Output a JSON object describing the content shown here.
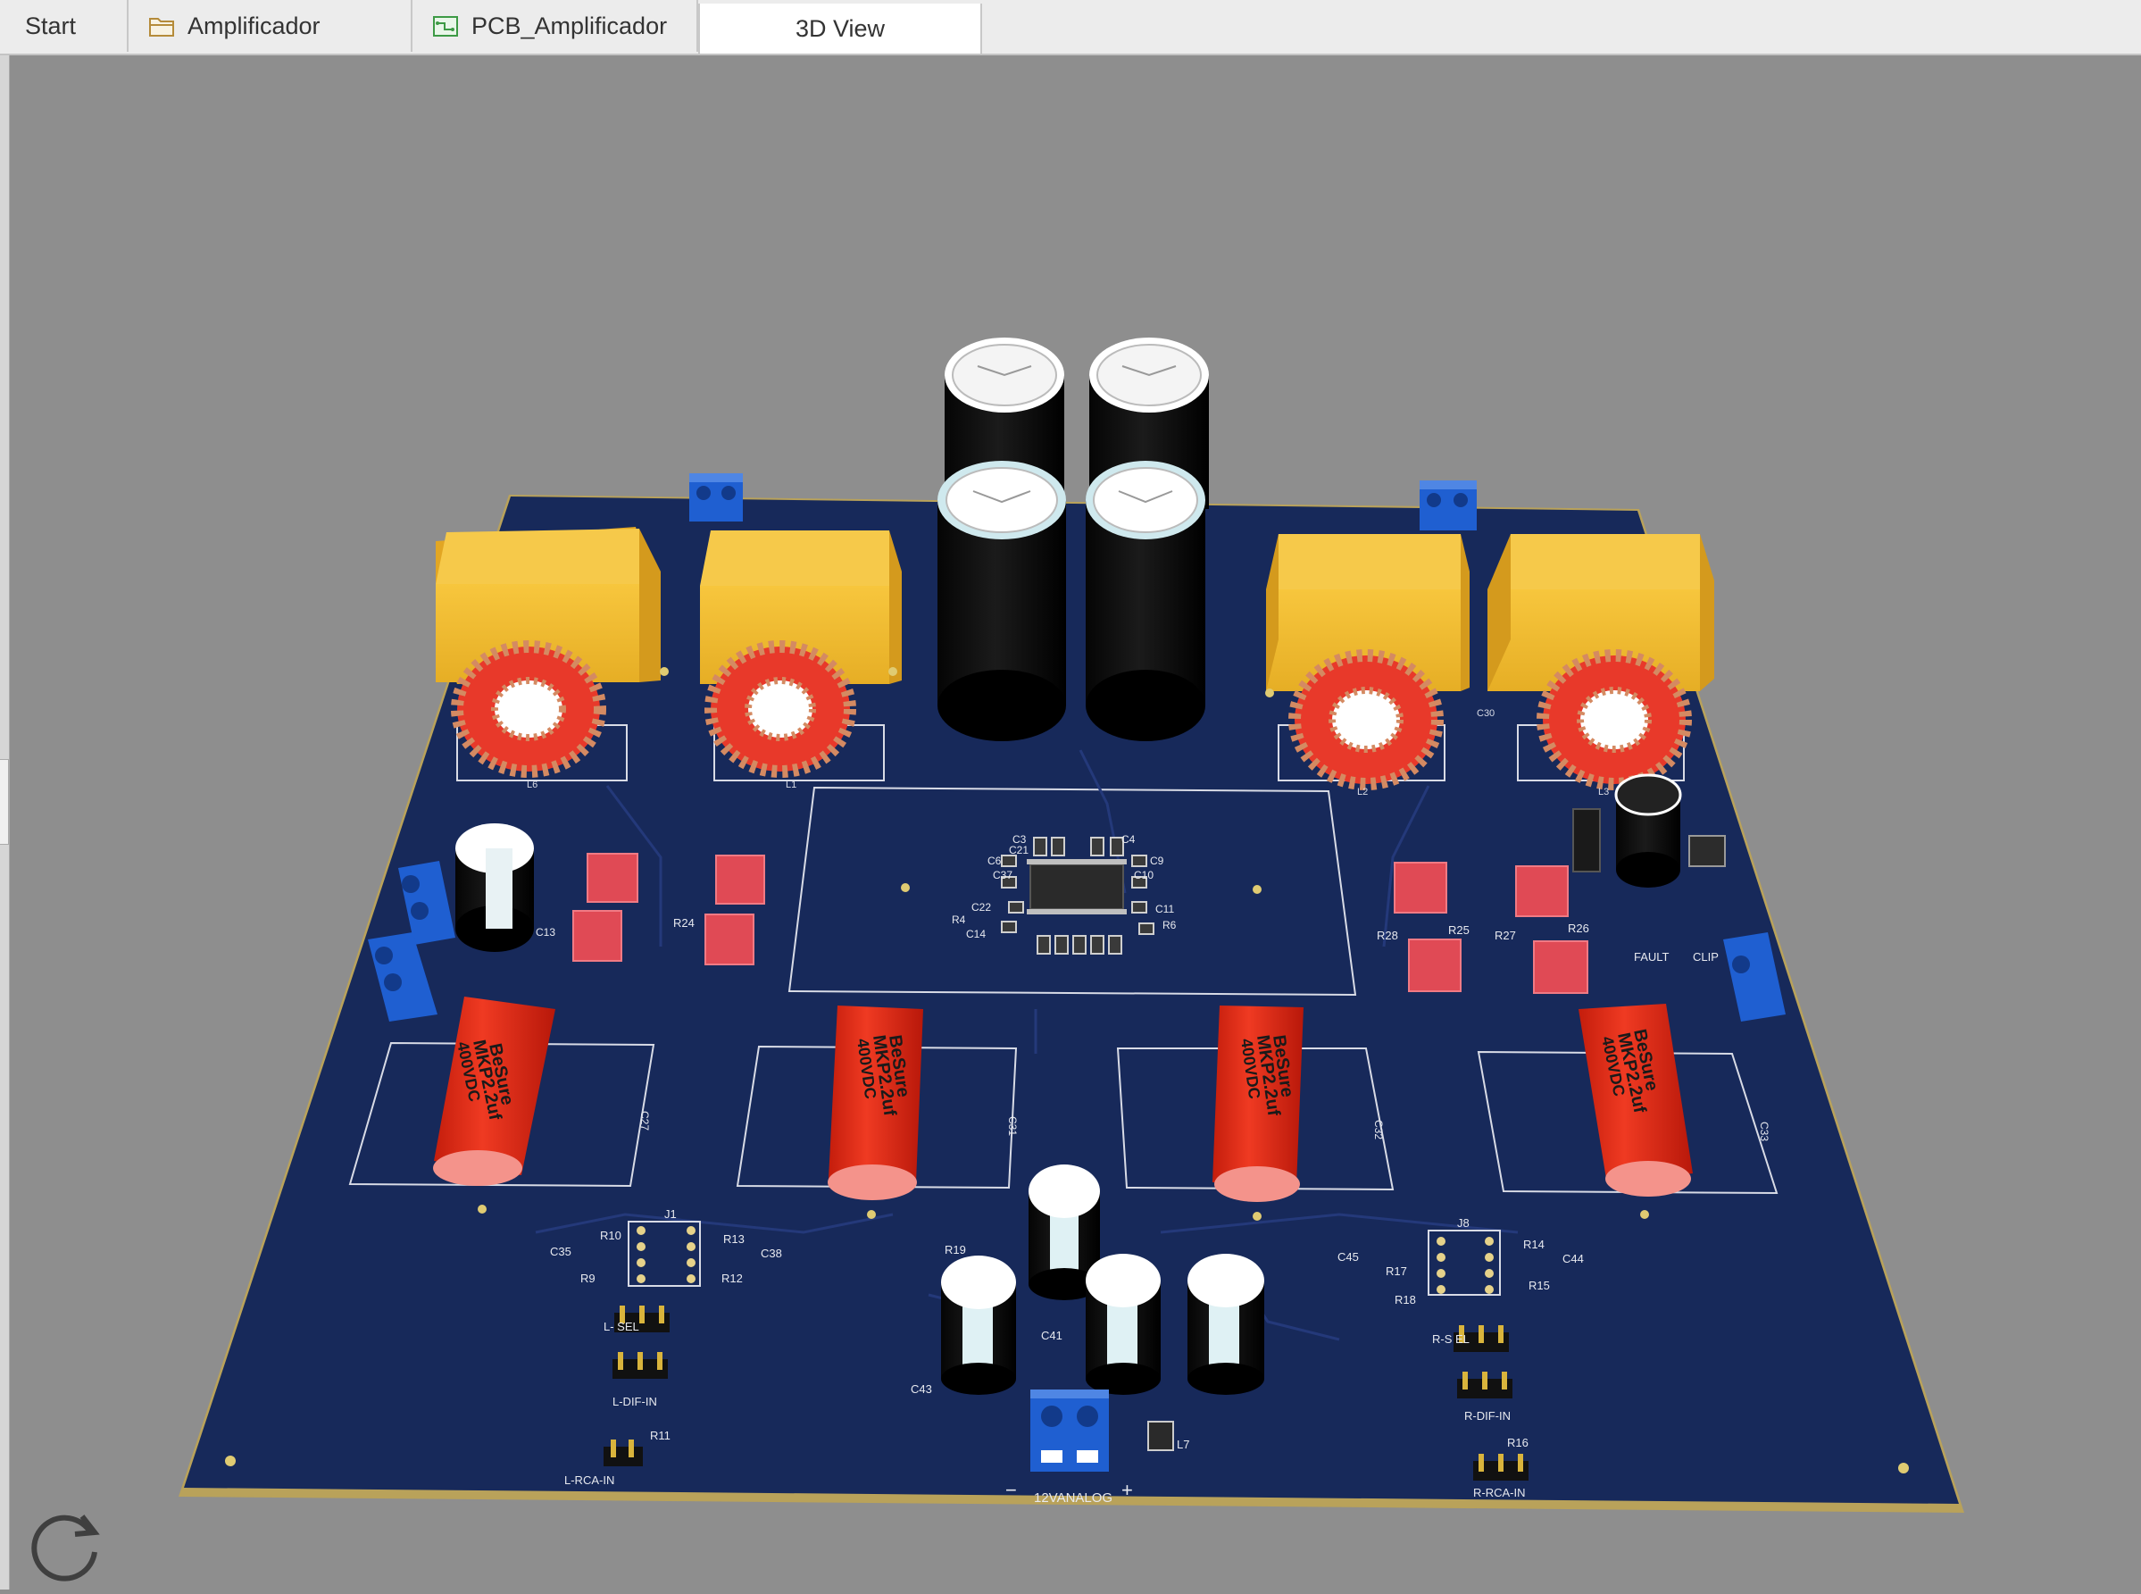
{
  "tabs": [
    {
      "label": "Start",
      "icon": "none"
    },
    {
      "label": "Amplificador",
      "icon": "folder-icon"
    },
    {
      "label": "PCB_Amplificador",
      "icon": "pcb-document-icon"
    },
    {
      "label": "3D View",
      "icon": "none"
    }
  ],
  "active_tab": "3D View",
  "pcb": {
    "inductor_labels": [
      "L6",
      "L1",
      "L2",
      "L3"
    ],
    "film_caps": [
      {
        "brand": "BeSure",
        "spec": "MKP2.2uf",
        "voltage": "400VDC",
        "ref": "C27"
      },
      {
        "brand": "BeSure",
        "spec": "MKP2.2uf",
        "voltage": "400VDC",
        "ref": "C31"
      },
      {
        "brand": "BeSure",
        "spec": "MKP2.2uf",
        "voltage": "400VDC",
        "ref": "C32"
      },
      {
        "brand": "BeSure",
        "spec": "MKP2.2uf",
        "voltage": "400VDC",
        "ref": "C33"
      }
    ],
    "refs": {
      "c3": "C3",
      "c4": "C4",
      "c21": "C21",
      "c6": "C6",
      "c9": "C9",
      "c37": "C37",
      "c10": "C10",
      "c22": "C22",
      "r4": "R4",
      "c14": "C14",
      "c11": "C11",
      "r6": "R6",
      "c13": "C13",
      "r24": "R24",
      "r28": "R28",
      "r25": "R25",
      "r27": "R27",
      "r26": "R26",
      "fault": "FAULT",
      "clip": "CLIP",
      "c30": "C30",
      "j1": "J1",
      "j8": "J8",
      "r10": "R10",
      "r13": "R13",
      "c35": "C35",
      "c38": "C38",
      "r9": "R9",
      "r12": "R12",
      "r19": "R19",
      "c41": "C41",
      "c43": "C43",
      "l7": "L7",
      "c45": "C45",
      "r14": "R14",
      "c44": "C44",
      "r17": "R17",
      "r15": "R15",
      "r18": "R18",
      "r11": "R11",
      "r16": "R16"
    },
    "connector_labels": {
      "l_sel": "L-     SEL",
      "l_dif": "L-DIF-IN",
      "l_rca": "L-RCA-IN",
      "r_sel": "R-S     EL",
      "r_dif": "R-DIF-IN",
      "r_rca": "R-RCA-IN",
      "power": "12VANALOG",
      "minus": "−",
      "plus": "+"
    }
  },
  "colors": {
    "board": "#17295a",
    "board_edge": "#b9a25a",
    "inductor_block": "#f3c033",
    "toroid_red": "#e8392a",
    "copper": "#d48a62",
    "terminal_blue": "#1f5fd1",
    "film_cap": "#d92a17",
    "smd_pad": "#e04a55"
  }
}
